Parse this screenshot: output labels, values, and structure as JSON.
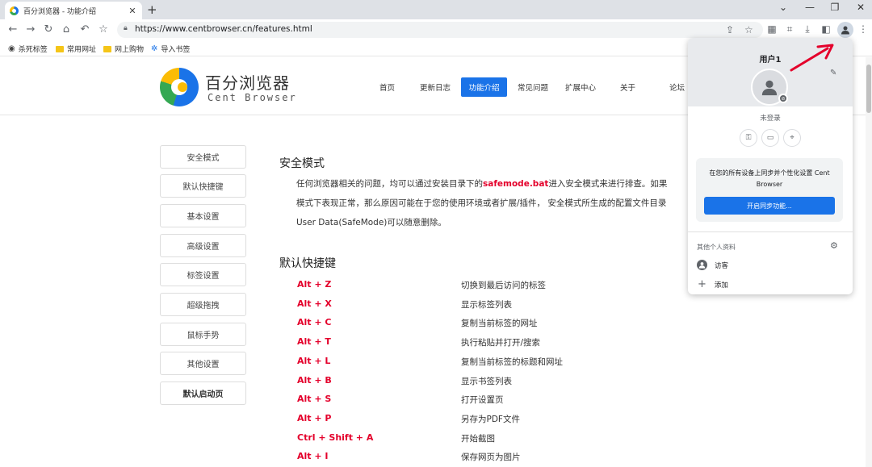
{
  "browser": {
    "tab_title": "百分浏览器 - 功能介绍",
    "url": "https://www.centbrowser.cn/features.html",
    "bookmarks": [
      "杀死标签",
      "常用网址",
      "网上购物",
      "导入书签"
    ]
  },
  "site": {
    "logo_cn": "百分浏览器",
    "logo_en": "Cent Browser",
    "nav": [
      "首页",
      "更新日志",
      "功能介绍",
      "常见问题",
      "扩展中心",
      "关于",
      "论坛"
    ],
    "active_nav": "功能介绍",
    "side_menu": [
      "安全模式",
      "默认快捷键",
      "基本设置",
      "高级设置",
      "标签设置",
      "超级拖拽",
      "鼠标手势",
      "其他设置",
      "默认启动页"
    ]
  },
  "content": {
    "safe_mode_title": "安全模式",
    "safe_mode_text_1": "任何浏览器相关的问题，均可以通过安装目录下的",
    "safe_mode_highlight": "safemode.bat",
    "safe_mode_text_2": "进入安全模式来进行排查。如果",
    "safe_mode_line2": "模式下表现正常，那么原因可能在于您的使用环境或者扩展/插件， 安全模式所生成的配置文件目录",
    "safe_mode_line3": "User Data(SafeMode)可以随意删除。",
    "shortcuts_title": "默认快捷键",
    "shortcuts": [
      {
        "key": "Alt + Z",
        "desc": "切换到最后访问的标签"
      },
      {
        "key": "Alt + X",
        "desc": "显示标签列表"
      },
      {
        "key": "Alt + C",
        "desc": "复制当前标签的网址"
      },
      {
        "key": "Alt + T",
        "desc": "执行粘贴并打开/搜索"
      },
      {
        "key": "Alt + L",
        "desc": "复制当前标签的标题和网址"
      },
      {
        "key": "Alt + B",
        "desc": "显示书签列表"
      },
      {
        "key": "Alt + S",
        "desc": "打开设置页"
      },
      {
        "key": "Alt + P",
        "desc": "另存为PDF文件"
      },
      {
        "key": "Ctrl + Shift + A",
        "desc": "开始截图"
      },
      {
        "key": "Alt + I",
        "desc": "保存网页为图片"
      }
    ]
  },
  "profile_popup": {
    "name": "用户1",
    "status": "未登录",
    "sync_text": "在您的所有设备上同步并个性化设置 Cent Browser",
    "sync_button": "开启同步功能...",
    "other_profiles": "其他个人资料",
    "guest": "访客",
    "add": "添加"
  },
  "colors": {
    "accent": "#1a73e8",
    "shortcut_key": "#e4002b",
    "arrow": "#e4002b"
  }
}
